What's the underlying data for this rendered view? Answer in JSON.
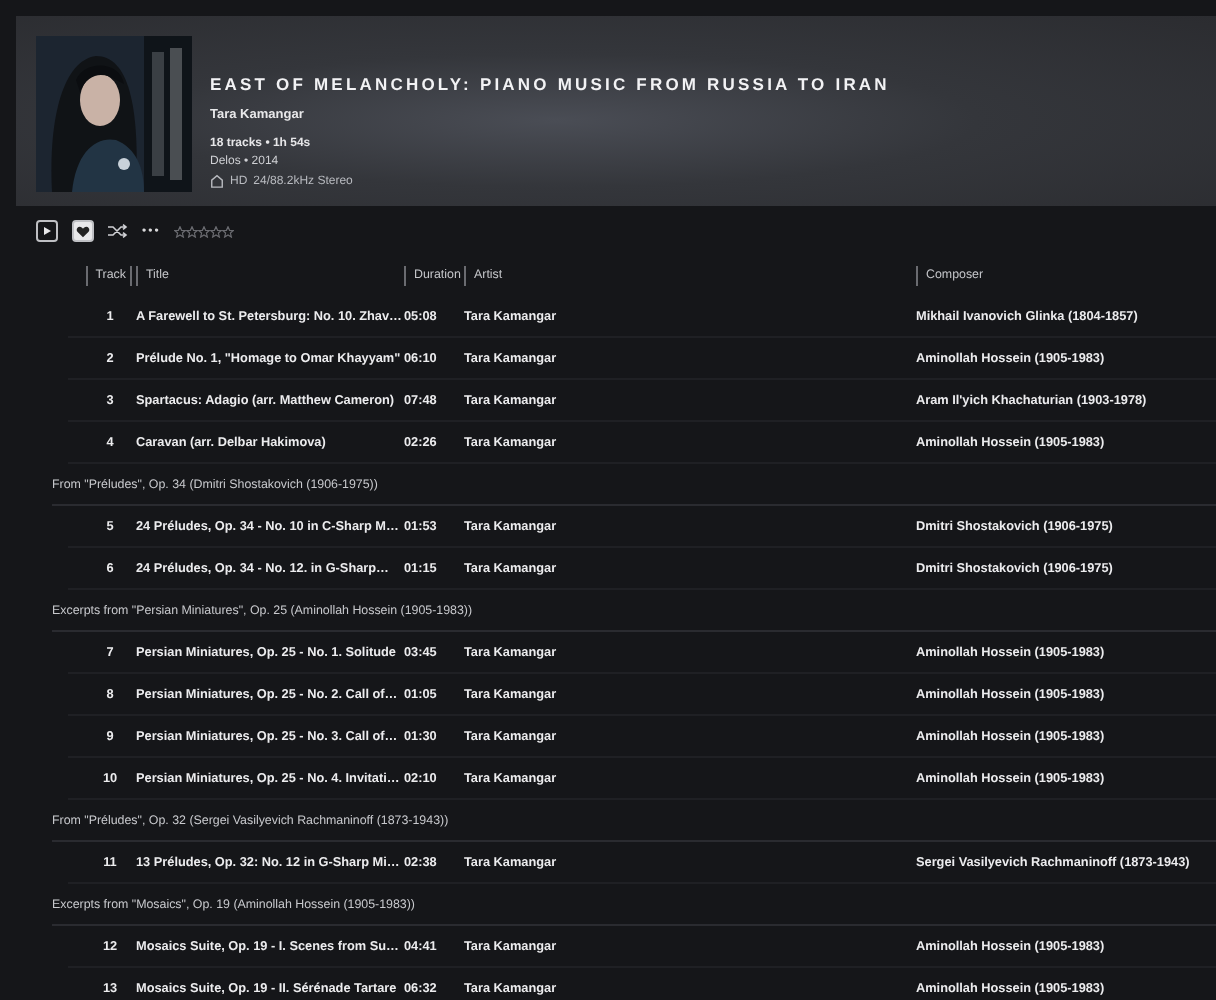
{
  "album": {
    "title": "EAST OF MELANCHOLY: PIANO MUSIC FROM RUSSIA TO IRAN",
    "artist": "Tara Kamangar",
    "summary": "18 tracks • 1h 54s",
    "label_year": "Delos • 2014",
    "quality_badge": "HD",
    "format": "24/88.2kHz Stereo"
  },
  "actions": {
    "favorite": true,
    "more": "•••",
    "stars": 0
  },
  "table": {
    "columns": [
      "Track",
      "Title",
      "Duration",
      "Artist",
      "Composer"
    ],
    "rows": [
      {
        "kind": "track",
        "track": "1",
        "title": "A Farewell to St. Petersburg: No. 10. Zhav…",
        "duration": "05:08",
        "artist": "Tara Kamangar",
        "composer": "Mikhail Ivanovich Glinka (1804-1857)"
      },
      {
        "kind": "track",
        "track": "2",
        "title": "Prélude No. 1, \"Homage to Omar Khayyam\"",
        "duration": "06:10",
        "artist": "Tara Kamangar",
        "composer": "Aminollah Hossein (1905-1983)"
      },
      {
        "kind": "track",
        "track": "3",
        "title": "Spartacus: Adagio (arr. Matthew Cameron)",
        "duration": "07:48",
        "artist": "Tara Kamangar",
        "composer": "Aram Il'yich Khachaturian (1903-1978)"
      },
      {
        "kind": "track",
        "track": "4",
        "title": "Caravan (arr. Delbar Hakimova)",
        "duration": "02:26",
        "artist": "Tara Kamangar",
        "composer": "Aminollah Hossein (1905-1983)"
      },
      {
        "kind": "group",
        "text": "From \"Préludes\", Op. 34 (Dmitri Shostakovich (1906-1975))"
      },
      {
        "kind": "track",
        "track": "5",
        "title": "24 Préludes, Op. 34 - No. 10 in C-Sharp M…",
        "duration": "01:53",
        "artist": "Tara Kamangar",
        "composer": "Dmitri Shostakovich (1906-1975)"
      },
      {
        "kind": "track",
        "track": "6",
        "title": "24 Préludes, Op. 34 - No. 12. in G-Sharp…",
        "duration": "01:15",
        "artist": "Tara Kamangar",
        "composer": "Dmitri Shostakovich (1906-1975)"
      },
      {
        "kind": "group",
        "text": "Excerpts from \"Persian Miniatures\", Op. 25 (Aminollah Hossein (1905-1983))"
      },
      {
        "kind": "track",
        "track": "7",
        "title": "Persian Miniatures, Op. 25 - No. 1. Solitude",
        "duration": "03:45",
        "artist": "Tara Kamangar",
        "composer": "Aminollah Hossein (1905-1983)"
      },
      {
        "kind": "track",
        "track": "8",
        "title": "Persian Miniatures, Op. 25 - No. 2. Call of…",
        "duration": "01:05",
        "artist": "Tara Kamangar",
        "composer": "Aminollah Hossein (1905-1983)"
      },
      {
        "kind": "track",
        "track": "9",
        "title": "Persian Miniatures, Op. 25 - No. 3. Call of…",
        "duration": "01:30",
        "artist": "Tara Kamangar",
        "composer": "Aminollah Hossein (1905-1983)"
      },
      {
        "kind": "track",
        "track": "10",
        "title": "Persian Miniatures, Op. 25 - No. 4. Invitati…",
        "duration": "02:10",
        "artist": "Tara Kamangar",
        "composer": "Aminollah Hossein (1905-1983)"
      },
      {
        "kind": "group",
        "text": "From \"Préludes\", Op. 32 (Sergei Vasilyevich Rachmaninoff (1873-1943))"
      },
      {
        "kind": "track",
        "track": "11",
        "title": "13 Préludes, Op. 32: No. 12 in G-Sharp Mi…",
        "duration": "02:38",
        "artist": "Tara Kamangar",
        "composer": "Sergei Vasilyevich Rachmaninoff (1873-1943)"
      },
      {
        "kind": "group",
        "text": "Excerpts from \"Mosaics\", Op. 19 (Aminollah Hossein (1905-1983))"
      },
      {
        "kind": "track",
        "track": "12",
        "title": "Mosaics Suite, Op. 19 - I. Scenes from Su…",
        "duration": "04:41",
        "artist": "Tara Kamangar",
        "composer": "Aminollah Hossein (1905-1983)"
      },
      {
        "kind": "track",
        "track": "13",
        "title": "Mosaics Suite, Op. 19 - II. Sérénade Tartare",
        "duration": "06:32",
        "artist": "Tara Kamangar",
        "composer": "Aminollah Hossein (1905-1983)"
      }
    ]
  }
}
